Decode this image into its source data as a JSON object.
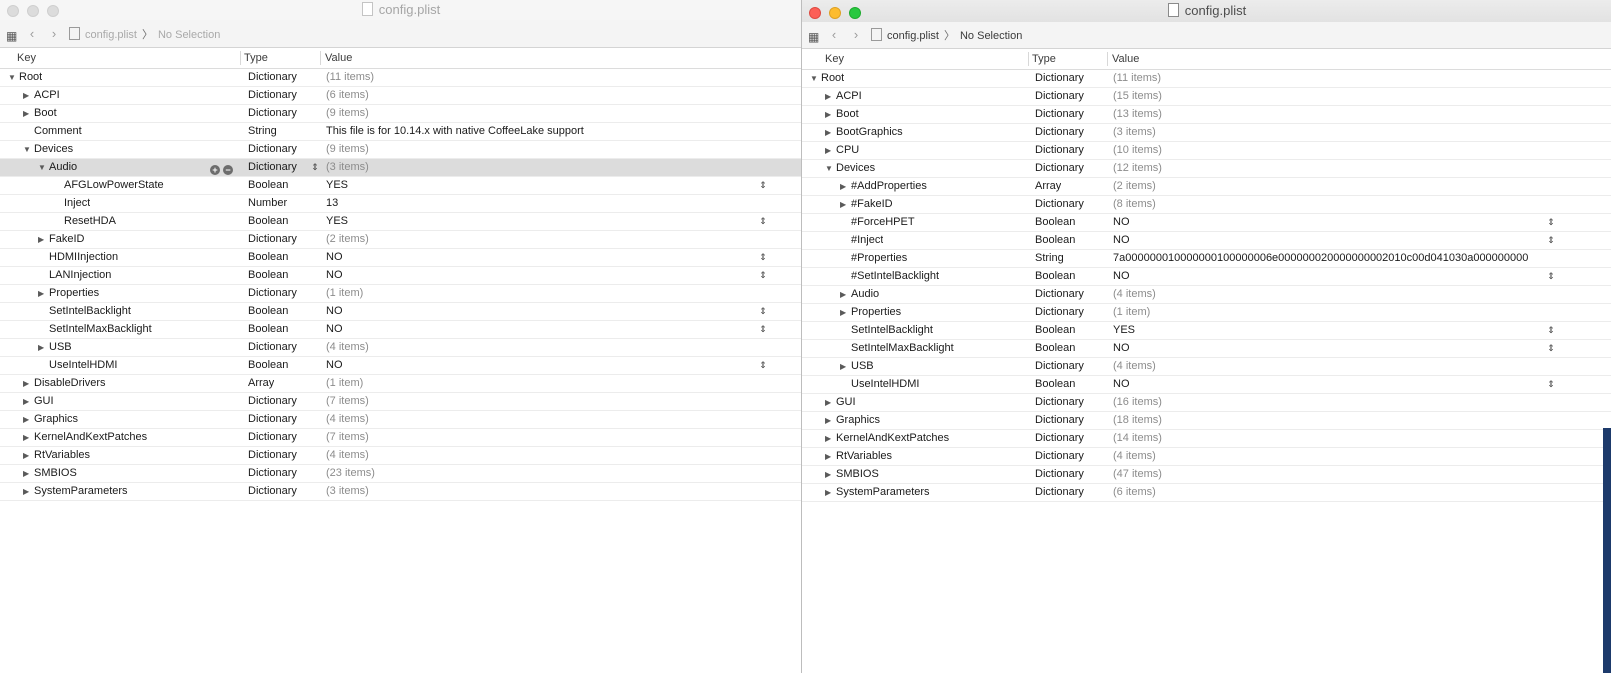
{
  "windows": [
    {
      "title": "config.plist",
      "path": {
        "file": "config.plist",
        "selection": "No Selection"
      },
      "columns": {
        "key": "Key",
        "type": "Type",
        "value": "Value"
      },
      "rows": [
        {
          "indent": 0,
          "tri": "down",
          "key": "Root",
          "type": "Dictionary",
          "value": "(11 items)",
          "dim": true
        },
        {
          "indent": 1,
          "tri": "right",
          "key": "ACPI",
          "type": "Dictionary",
          "value": "(6 items)",
          "dim": true
        },
        {
          "indent": 1,
          "tri": "right",
          "key": "Boot",
          "type": "Dictionary",
          "value": "(9 items)",
          "dim": true
        },
        {
          "indent": 1,
          "tri": "",
          "key": "Comment",
          "type": "String",
          "value": "This file is for 10.14.x with native CoffeeLake support",
          "dim": false
        },
        {
          "indent": 1,
          "tri": "down",
          "key": "Devices",
          "type": "Dictionary",
          "value": "(9 items)",
          "dim": true
        },
        {
          "indent": 2,
          "tri": "down",
          "key": "Audio",
          "type": "Dictionary",
          "value": "(3 items)",
          "dim": true,
          "selected": true,
          "addrem": true,
          "stepper": true
        },
        {
          "indent": 3,
          "tri": "",
          "key": "AFGLowPowerState",
          "type": "Boolean",
          "value": "YES",
          "dim": false,
          "stepper": true
        },
        {
          "indent": 3,
          "tri": "",
          "key": "Inject",
          "type": "Number",
          "value": "13",
          "dim": false
        },
        {
          "indent": 3,
          "tri": "",
          "key": "ResetHDA",
          "type": "Boolean",
          "value": "YES",
          "dim": false,
          "stepper": true
        },
        {
          "indent": 2,
          "tri": "right",
          "key": "FakeID",
          "type": "Dictionary",
          "value": "(2 items)",
          "dim": true
        },
        {
          "indent": 2,
          "tri": "",
          "key": "HDMIInjection",
          "type": "Boolean",
          "value": "NO",
          "dim": false,
          "stepper": true
        },
        {
          "indent": 2,
          "tri": "",
          "key": "LANInjection",
          "type": "Boolean",
          "value": "NO",
          "dim": false,
          "stepper": true
        },
        {
          "indent": 2,
          "tri": "right",
          "key": "Properties",
          "type": "Dictionary",
          "value": "(1 item)",
          "dim": true
        },
        {
          "indent": 2,
          "tri": "",
          "key": "SetIntelBacklight",
          "type": "Boolean",
          "value": "NO",
          "dim": false,
          "stepper": true
        },
        {
          "indent": 2,
          "tri": "",
          "key": "SetIntelMaxBacklight",
          "type": "Boolean",
          "value": "NO",
          "dim": false,
          "stepper": true
        },
        {
          "indent": 2,
          "tri": "right",
          "key": "USB",
          "type": "Dictionary",
          "value": "(4 items)",
          "dim": true
        },
        {
          "indent": 2,
          "tri": "",
          "key": "UseIntelHDMI",
          "type": "Boolean",
          "value": "NO",
          "dim": false,
          "stepper": true
        },
        {
          "indent": 1,
          "tri": "right",
          "key": "DisableDrivers",
          "type": "Array",
          "value": "(1 item)",
          "dim": true
        },
        {
          "indent": 1,
          "tri": "right",
          "key": "GUI",
          "type": "Dictionary",
          "value": "(7 items)",
          "dim": true
        },
        {
          "indent": 1,
          "tri": "right",
          "key": "Graphics",
          "type": "Dictionary",
          "value": "(4 items)",
          "dim": true
        },
        {
          "indent": 1,
          "tri": "right",
          "key": "KernelAndKextPatches",
          "type": "Dictionary",
          "value": "(7 items)",
          "dim": true
        },
        {
          "indent": 1,
          "tri": "right",
          "key": "RtVariables",
          "type": "Dictionary",
          "value": "(4 items)",
          "dim": true
        },
        {
          "indent": 1,
          "tri": "right",
          "key": "SMBIOS",
          "type": "Dictionary",
          "value": "(23 items)",
          "dim": true
        },
        {
          "indent": 1,
          "tri": "right",
          "key": "SystemParameters",
          "type": "Dictionary",
          "value": "(3 items)",
          "dim": true
        }
      ]
    },
    {
      "title": "config.plist",
      "path": {
        "file": "config.plist",
        "selection": "No Selection"
      },
      "columns": {
        "key": "Key",
        "type": "Type",
        "value": "Value"
      },
      "rows": [
        {
          "indent": 0,
          "tri": "down",
          "key": "Root",
          "type": "Dictionary",
          "value": "(11 items)",
          "dim": true
        },
        {
          "indent": 1,
          "tri": "right",
          "key": "ACPI",
          "type": "Dictionary",
          "value": "(15 items)",
          "dim": true
        },
        {
          "indent": 1,
          "tri": "right",
          "key": "Boot",
          "type": "Dictionary",
          "value": "(13 items)",
          "dim": true
        },
        {
          "indent": 1,
          "tri": "right",
          "key": "BootGraphics",
          "type": "Dictionary",
          "value": "(3 items)",
          "dim": true
        },
        {
          "indent": 1,
          "tri": "right",
          "key": "CPU",
          "type": "Dictionary",
          "value": "(10 items)",
          "dim": true
        },
        {
          "indent": 1,
          "tri": "down",
          "key": "Devices",
          "type": "Dictionary",
          "value": "(12 items)",
          "dim": true
        },
        {
          "indent": 2,
          "tri": "right",
          "key": "#AddProperties",
          "type": "Array",
          "value": "(2 items)",
          "dim": true
        },
        {
          "indent": 2,
          "tri": "right",
          "key": "#FakeID",
          "type": "Dictionary",
          "value": "(8 items)",
          "dim": true
        },
        {
          "indent": 2,
          "tri": "",
          "key": "#ForceHPET",
          "type": "Boolean",
          "value": "NO",
          "dim": false,
          "stepper": true
        },
        {
          "indent": 2,
          "tri": "",
          "key": "#Inject",
          "type": "Boolean",
          "value": "NO",
          "dim": false,
          "stepper": true
        },
        {
          "indent": 2,
          "tri": "",
          "key": "#Properties",
          "type": "String",
          "value": "7a000000010000000100000006e000000020000000002010c00d041030a000000000",
          "dim": false
        },
        {
          "indent": 2,
          "tri": "",
          "key": "#SetIntelBacklight",
          "type": "Boolean",
          "value": "NO",
          "dim": false,
          "stepper": true
        },
        {
          "indent": 2,
          "tri": "right",
          "key": "Audio",
          "type": "Dictionary",
          "value": "(4 items)",
          "dim": true
        },
        {
          "indent": 2,
          "tri": "right",
          "key": "Properties",
          "type": "Dictionary",
          "value": "(1 item)",
          "dim": true
        },
        {
          "indent": 2,
          "tri": "",
          "key": "SetIntelBacklight",
          "type": "Boolean",
          "value": "YES",
          "dim": false,
          "stepper": true
        },
        {
          "indent": 2,
          "tri": "",
          "key": "SetIntelMaxBacklight",
          "type": "Boolean",
          "value": "NO",
          "dim": false,
          "stepper": true
        },
        {
          "indent": 2,
          "tri": "right",
          "key": "USB",
          "type": "Dictionary",
          "value": "(4 items)",
          "dim": true
        },
        {
          "indent": 2,
          "tri": "",
          "key": "UseIntelHDMI",
          "type": "Boolean",
          "value": "NO",
          "dim": false,
          "stepper": true
        },
        {
          "indent": 1,
          "tri": "right",
          "key": "GUI",
          "type": "Dictionary",
          "value": "(16 items)",
          "dim": true
        },
        {
          "indent": 1,
          "tri": "right",
          "key": "Graphics",
          "type": "Dictionary",
          "value": "(18 items)",
          "dim": true
        },
        {
          "indent": 1,
          "tri": "right",
          "key": "KernelAndKextPatches",
          "type": "Dictionary",
          "value": "(14 items)",
          "dim": true
        },
        {
          "indent": 1,
          "tri": "right",
          "key": "RtVariables",
          "type": "Dictionary",
          "value": "(4 items)",
          "dim": true
        },
        {
          "indent": 1,
          "tri": "right",
          "key": "SMBIOS",
          "type": "Dictionary",
          "value": "(47 items)",
          "dim": true
        },
        {
          "indent": 1,
          "tri": "right",
          "key": "SystemParameters",
          "type": "Dictionary",
          "value": "(6 items)",
          "dim": true
        }
      ]
    }
  ],
  "icons": {
    "grid": "grid-view-icon",
    "back": "back-arrow-icon",
    "forward": "forward-arrow-icon",
    "file": "document-icon",
    "expanded": "disclosure-down-icon",
    "collapsed": "disclosure-right-icon",
    "stepper": "stepper-icon",
    "add": "add-item-icon",
    "remove": "remove-item-icon"
  },
  "colors": {
    "close": "#fc5f57",
    "minimize": "#fdbc2e",
    "zoom": "#28c840",
    "selection": "#dcdcdc",
    "desktop": "#1d3a6b"
  }
}
